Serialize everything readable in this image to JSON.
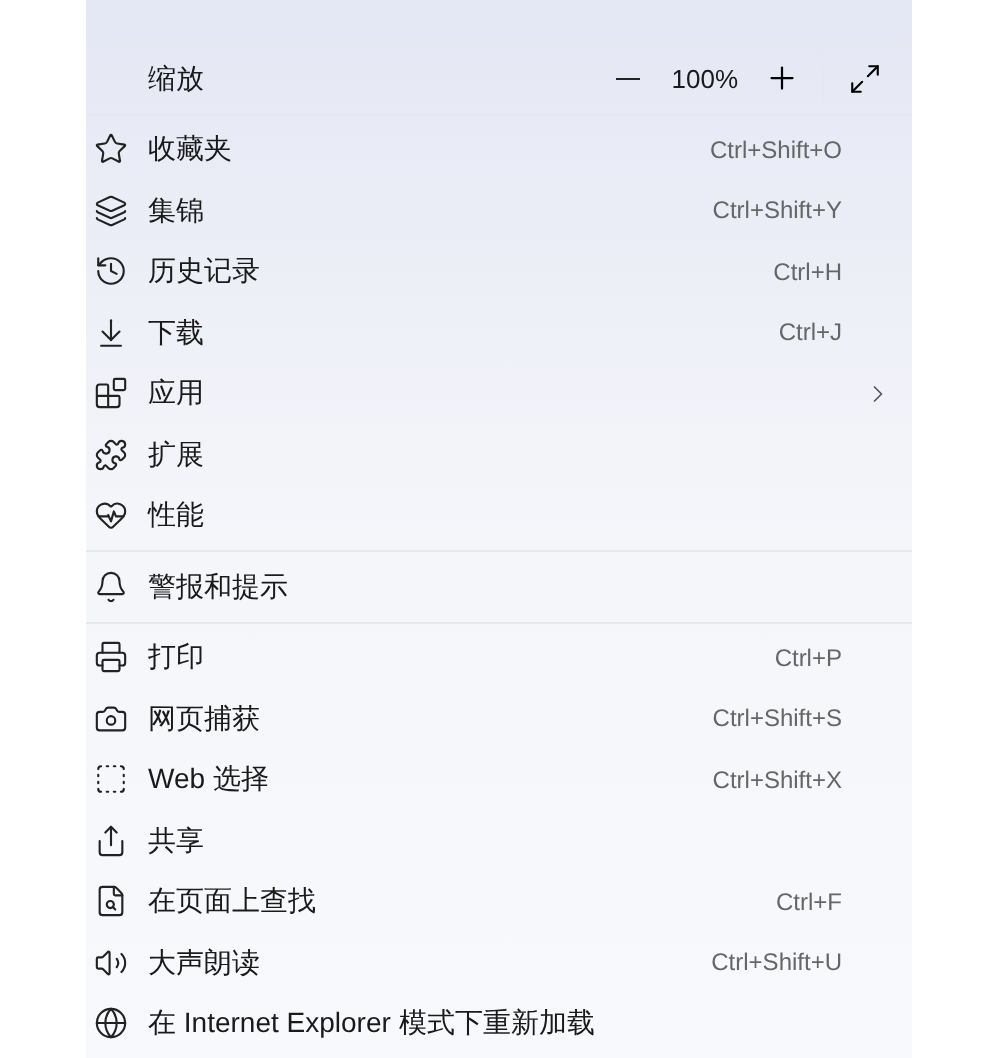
{
  "zoom": {
    "label": "缩放",
    "value": "100%"
  },
  "sections": [
    {
      "items": [
        {
          "label": "收藏夹",
          "shortcut": "Ctrl+Shift+O",
          "has_submenu": false
        },
        {
          "label": "集锦",
          "shortcut": "Ctrl+Shift+Y",
          "has_submenu": false
        },
        {
          "label": "历史记录",
          "shortcut": "Ctrl+H",
          "has_submenu": false
        },
        {
          "label": "下载",
          "shortcut": "Ctrl+J",
          "has_submenu": false
        },
        {
          "label": "应用",
          "has_submenu": true
        },
        {
          "label": "扩展",
          "has_submenu": false
        },
        {
          "label": "性能",
          "has_submenu": false
        }
      ]
    },
    {
      "items": [
        {
          "label": "警报和提示",
          "has_submenu": false
        }
      ]
    },
    {
      "items": [
        {
          "label": "打印",
          "shortcut": "Ctrl+P",
          "has_submenu": false
        },
        {
          "label": "网页捕获",
          "shortcut": "Ctrl+Shift+S",
          "has_submenu": false
        },
        {
          "label": "Web 选择",
          "shortcut": "Ctrl+Shift+X",
          "has_submenu": false
        },
        {
          "label": "共享",
          "has_submenu": false
        },
        {
          "label": "在页面上查找",
          "shortcut": "Ctrl+F",
          "has_submenu": false
        },
        {
          "label": "大声朗读",
          "shortcut": "Ctrl+Shift+U",
          "has_submenu": false
        },
        {
          "label": "在 Internet Explorer 模式下重新加载",
          "has_submenu": false
        }
      ]
    }
  ]
}
